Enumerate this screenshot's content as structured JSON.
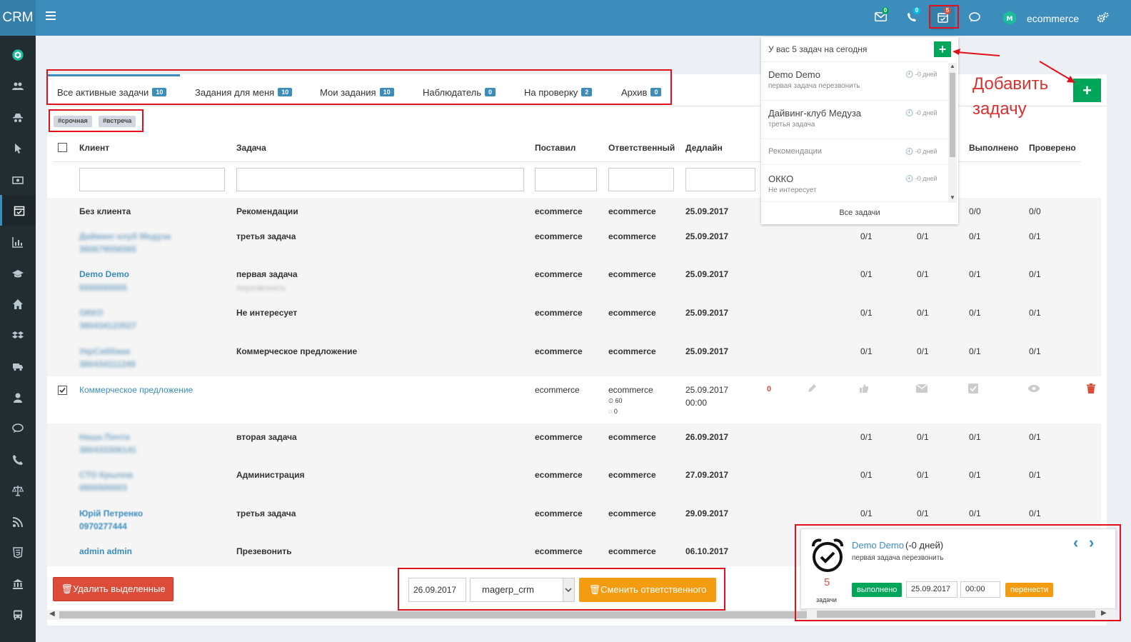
{
  "app": {
    "logo": "CRM",
    "user": "ecommerce"
  },
  "header": {
    "mail_badge": "0",
    "phone_badge": "0",
    "tasks_badge": "5"
  },
  "tabs": [
    {
      "label": "Все активные задачи",
      "count": "10"
    },
    {
      "label": "Задания для меня",
      "count": "10"
    },
    {
      "label": "Мои задания",
      "count": "10"
    },
    {
      "label": "Наблюдатель",
      "count": "0"
    },
    {
      "label": "На проверку",
      "count": "2"
    },
    {
      "label": "Архив",
      "count": "0"
    }
  ],
  "tags": [
    "#срочная",
    "#встреча"
  ],
  "columns": {
    "client": "Клиент",
    "task": "Задача",
    "set_by": "Поставил",
    "responsible": "Ответственный",
    "deadline": "Дедлайн",
    "done": "Выполнено",
    "checked": "Проверено"
  },
  "rows": [
    {
      "client": "Без клиента",
      "phone": "",
      "task": "Рекомендации",
      "task_sub": "",
      "set_by": "ecommerce",
      "resp": "ecommerce",
      "deadline": "25.09.2017",
      "r1": "",
      "r2": "",
      "r3": "0/0",
      "r4": "0/0"
    },
    {
      "client": "Дайвинг-клуб Медуза",
      "phone": "380679056565",
      "task": "третья задача",
      "task_sub": "",
      "set_by": "ecommerce",
      "resp": "ecommerce",
      "deadline": "25.09.2017",
      "r1": "0/1",
      "r2": "0/1",
      "r3": "0/1",
      "r4": "0/1"
    },
    {
      "client": "Demo Demo",
      "phone": "5555555555",
      "task": "первая задача",
      "task_sub": "перезвонить",
      "set_by": "ecommerce",
      "resp": "ecommerce",
      "deadline": "25.09.2017",
      "r1": "0/1",
      "r2": "0/1",
      "r3": "0/1",
      "r4": "0/1"
    },
    {
      "client": "ОККО",
      "phone": "380434123527",
      "task": "Не интересует",
      "task_sub": "",
      "set_by": "ecommerce",
      "resp": "ecommerce",
      "deadline": "25.09.2017",
      "r1": "0/1",
      "r2": "0/1",
      "r3": "0/1",
      "r4": "0/1"
    },
    {
      "client": "УкрСиббанк",
      "phone": "380434111249",
      "task": "Коммерческое предложение",
      "task_sub": "",
      "set_by": "ecommerce",
      "resp": "ecommerce",
      "deadline": "25.09.2017",
      "r1": "0/1",
      "r2": "0/1",
      "r3": "0/1",
      "r4": "0/1"
    },
    {
      "client": "Наша Почта",
      "phone": "380433306141",
      "task": "вторая задача",
      "task_sub": "",
      "set_by": "ecommerce",
      "resp": "ecommerce",
      "deadline": "26.09.2017",
      "r1": "0/1",
      "r2": "0/1",
      "r3": "0/1",
      "r4": "0/1"
    },
    {
      "client": "СТО Крылов",
      "phone": "0800500003",
      "task": "Администрация",
      "task_sub": "",
      "set_by": "ecommerce",
      "resp": "ecommerce",
      "deadline": "27.09.2017",
      "r1": "0/1",
      "r2": "0/1",
      "r3": "0/1",
      "r4": "0/1"
    },
    {
      "client": "Юрій Петренко",
      "phone": "0970277444",
      "task": "третья задача",
      "task_sub": "",
      "set_by": "ecommerce",
      "resp": "ecommerce",
      "deadline": "29.09.2017",
      "r1": "0/1",
      "r2": "0/1",
      "r3": "0/1",
      "r4": "0/1"
    },
    {
      "client": "admin admin",
      "phone": "",
      "task": "Презевонить",
      "task_sub": "",
      "set_by": "ecommerce",
      "resp": "ecommerce",
      "deadline": "06.10.2017",
      "r1": "",
      "r2": "",
      "r3": "",
      "r4": ""
    }
  ],
  "selected_row": {
    "client": "Коммерческое предложение",
    "set_by": "ecommerce",
    "resp": "ecommerce",
    "resp_time": "60",
    "resp_wait": "0",
    "deadline": "25.09.2017",
    "deadline_time": "00:00",
    "count": "0"
  },
  "actions": {
    "delete": "Удалить выделенные",
    "date": "26.09.2017",
    "user_select": "magerp_crm",
    "change": "Сменить ответственного"
  },
  "dropdown": {
    "header": "У вас 5 задач на сегодня",
    "items": [
      {
        "title": "Demo Demo",
        "sub": "первая задача перезвонить",
        "time": "-0 дней"
      },
      {
        "title": "Дайвинг-клуб Медуза",
        "sub": "третья задача",
        "time": "-0 дней"
      },
      {
        "title": "Рекомендации",
        "sub": "",
        "time": "-0 дней"
      },
      {
        "title": "ОККО",
        "sub": "Не интересует",
        "time": "-0 дней"
      }
    ],
    "all": "Все задачи"
  },
  "annotation": {
    "line1": "Добавить",
    "line2": "задачу"
  },
  "notification": {
    "name": "Demo Demo",
    "days": "(-0 дней)",
    "desc": "первая задача перезвонить",
    "count": "5",
    "count_label": "задачи",
    "done": "выполнено",
    "date": "25.09.2017",
    "time": "00:00",
    "move": "перенести"
  }
}
